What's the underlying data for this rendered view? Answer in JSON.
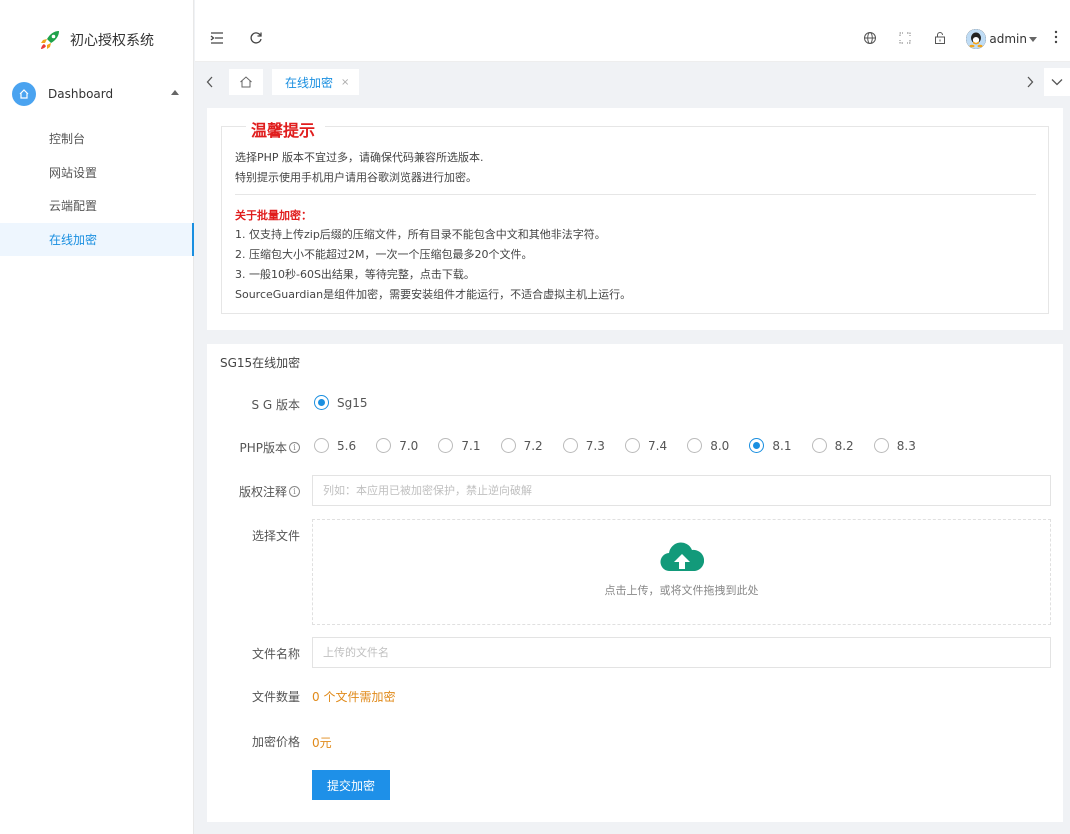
{
  "app": {
    "title": "初心授权系统"
  },
  "sidebar": {
    "group_label": "Dashboard",
    "items": [
      {
        "label": "控制台"
      },
      {
        "label": "网站设置"
      },
      {
        "label": "云端配置"
      },
      {
        "label": "在线加密",
        "active": true
      }
    ]
  },
  "header": {
    "user": "admin"
  },
  "tabs": {
    "active_label": "在线加密",
    "close_glyph": "×"
  },
  "notice": {
    "title": "温馨提示",
    "lines": [
      "选择PHP 版本不宜过多，请确保代码兼容所选版本.",
      "特别提示使用手机用户请用谷歌浏览器进行加密。"
    ],
    "batch_title": "关于批量加密：",
    "batch_lines": [
      "1. 仅支持上传zip后缀的压缩文件，所有目录不能包含中文和其他非法字符。",
      "2. 压缩包大小不能超过2M，一次一个压缩包最多20个文件。",
      "3. 一般10秒-60S出结果，等待完整，点击下载。",
      "SourceGuardian是组件加密，需要安装组件才能运行，不适合虚拟主机上运行。"
    ]
  },
  "form": {
    "title": "SG15在线加密",
    "sg_label": "S G 版本",
    "sg_option": "Sg15",
    "php_label": "PHP版本",
    "php_options": [
      "5.6",
      "7.0",
      "7.1",
      "7.2",
      "7.3",
      "7.4",
      "8.0",
      "8.1",
      "8.2",
      "8.3"
    ],
    "php_selected": "8.1",
    "copyright_label": "版权注释",
    "copyright_placeholder": "列如：本应用已被加密保护，禁止逆向破解",
    "file_label": "选择文件",
    "upload_hint": "点击上传，或将文件拖拽到此处",
    "filename_label": "文件名称",
    "filename_placeholder": "上传的文件名",
    "count_label": "文件数量",
    "count_value": "0 个文件需加密",
    "price_label": "加密价格",
    "price_value": "0元",
    "submit_label": "提交加密"
  },
  "colors": {
    "accent": "#1a8fe0",
    "warning": "#e01d1d",
    "orange": "#e08a1a",
    "upload_icon": "#129a7a"
  }
}
